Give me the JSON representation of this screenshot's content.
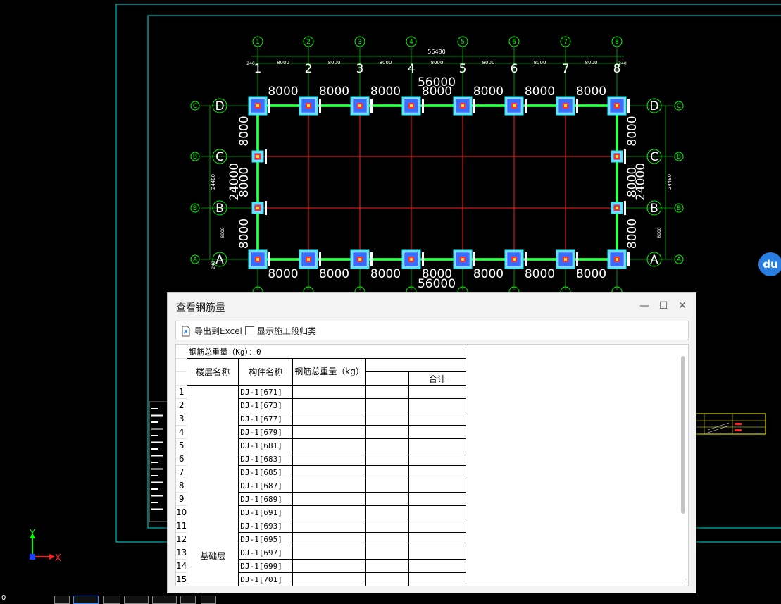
{
  "drawing": {
    "grid_numbers": [
      "1",
      "2",
      "3",
      "4",
      "5",
      "6",
      "7",
      "8"
    ],
    "grid_letters_left": [
      "D",
      "C",
      "B",
      "A"
    ],
    "grid_letters_right": [
      "D",
      "C",
      "B",
      "A"
    ],
    "bubble_letters": [
      "C",
      "B",
      "B",
      "A"
    ],
    "overall_width_small": "56480",
    "overall_width": "56000",
    "overall_height": "24000",
    "overall_height_small": "24480",
    "span_dim": "8000",
    "span_dim_small": "8000",
    "edge_dim": "240",
    "axis_y": "Y",
    "axis_x": "X",
    "status_coord": "0"
  },
  "badge": {
    "label": "du"
  },
  "dialog": {
    "title": "查看钢筋量",
    "minimize": "—",
    "maximize": "☐",
    "close": "✕",
    "toolbar": {
      "export_label": "导出到Excel",
      "show_stage_label": "显示施工段归类",
      "show_stage_checked": false
    },
    "report": {
      "total_label": "钢筋总重量（Kg）：0",
      "col_floor": "楼层名称",
      "col_component": "构件名称",
      "col_total_weight": "钢筋总重量（kg）",
      "col_sum": "合计",
      "floor_name": "基础层",
      "rows": [
        {
          "n": "1",
          "name": "DJ-1[671]"
        },
        {
          "n": "2",
          "name": "DJ-1[673]"
        },
        {
          "n": "3",
          "name": "DJ-1[677]"
        },
        {
          "n": "4",
          "name": "DJ-1[679]"
        },
        {
          "n": "5",
          "name": "DJ-1[681]"
        },
        {
          "n": "6",
          "name": "DJ-1[683]"
        },
        {
          "n": "7",
          "name": "DJ-1[685]"
        },
        {
          "n": "8",
          "name": "DJ-1[687]"
        },
        {
          "n": "9",
          "name": "DJ-1[689]"
        },
        {
          "n": "10",
          "name": "DJ-1[691]"
        },
        {
          "n": "11",
          "name": "DJ-1[693]"
        },
        {
          "n": "12",
          "name": "DJ-1[695]"
        },
        {
          "n": "13",
          "name": "DJ-1[697]"
        },
        {
          "n": "14",
          "name": "DJ-1[699]"
        },
        {
          "n": "15",
          "name": "DJ-1[701]"
        }
      ]
    }
  }
}
